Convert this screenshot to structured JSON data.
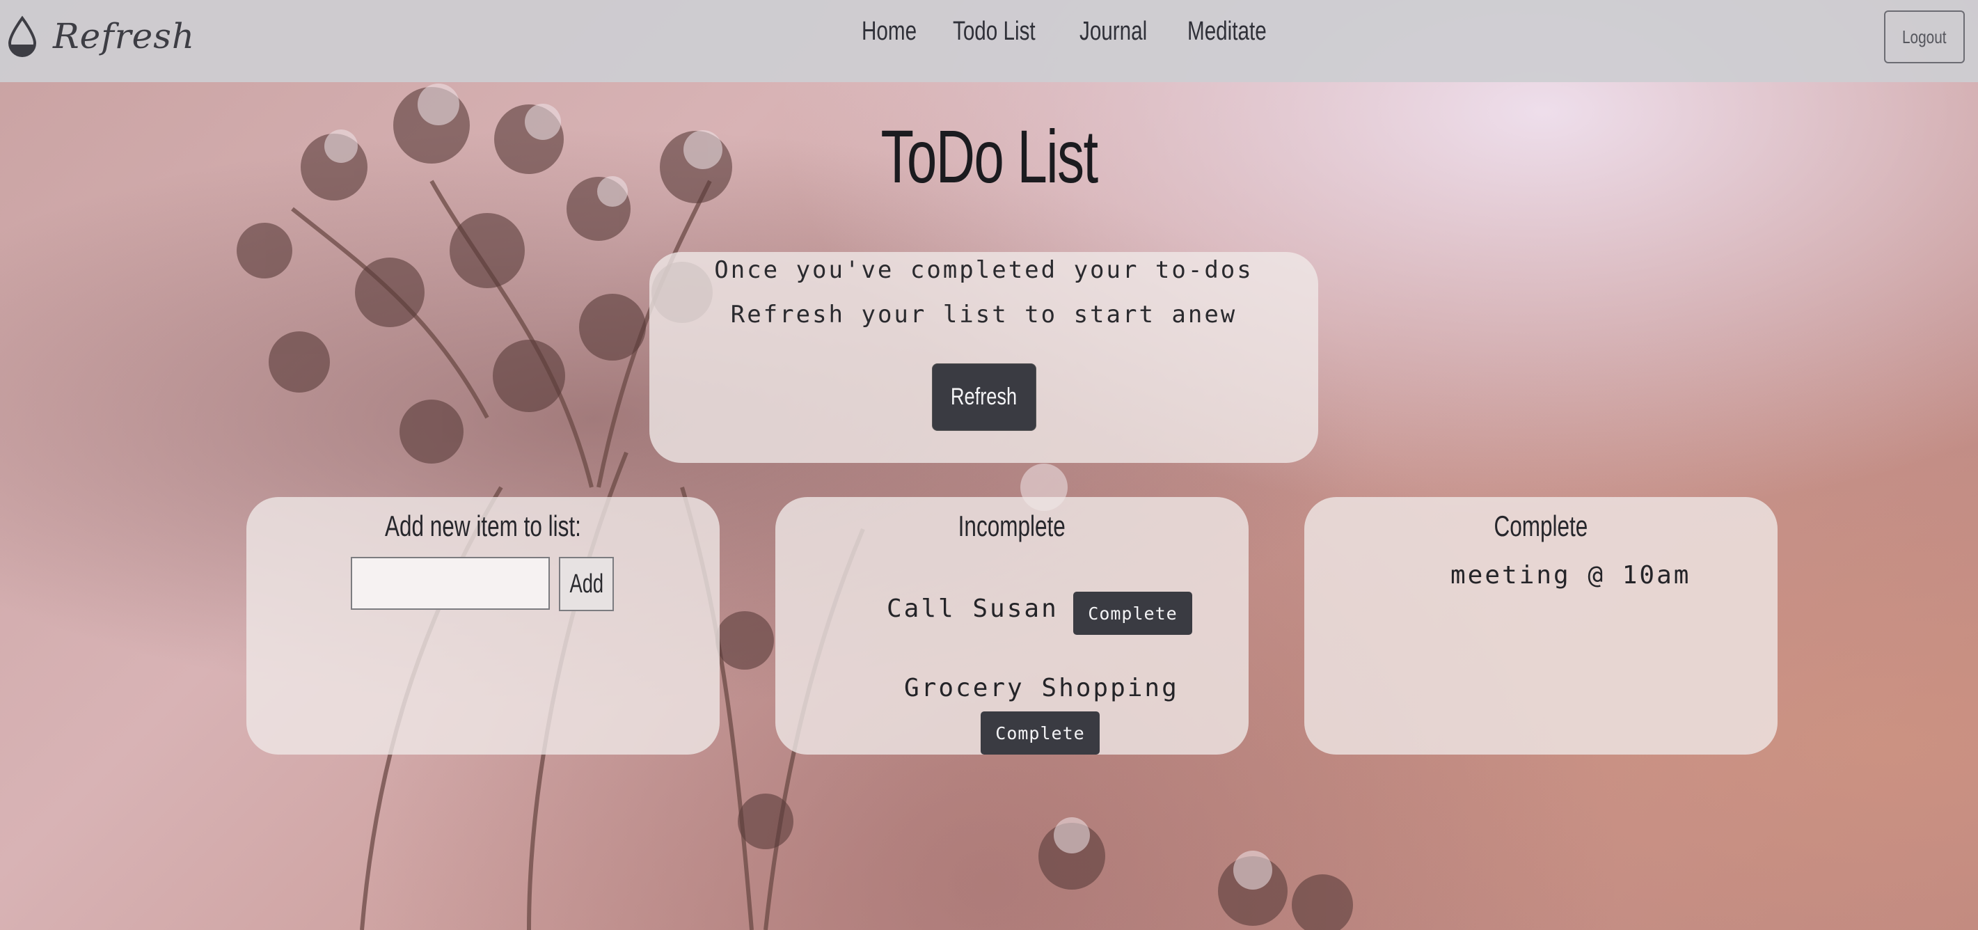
{
  "navbar": {
    "brand": "Refresh",
    "links": [
      "Home",
      "Todo List",
      "Journal",
      "Meditate"
    ],
    "logout": "Logout"
  },
  "page_title": "ToDo List",
  "refresh_card": {
    "line1": "Once you've completed your to-dos",
    "line2": "Refresh your list to start anew",
    "button": "Refresh"
  },
  "add_panel": {
    "heading": "Add new item to list:",
    "input_value": "",
    "button": "Add"
  },
  "incomplete_panel": {
    "heading": "Incomplete",
    "items": [
      {
        "text": "Call Susan",
        "button": "Complete"
      },
      {
        "text": "Grocery Shopping",
        "button": "Complete"
      }
    ]
  },
  "complete_panel": {
    "heading": "Complete",
    "items": [
      "meeting @ 10am"
    ]
  },
  "colors": {
    "nav_bg": "#cdcdd2",
    "button_dark": "#3a3b42",
    "card_bg": "#f0e9e8"
  }
}
